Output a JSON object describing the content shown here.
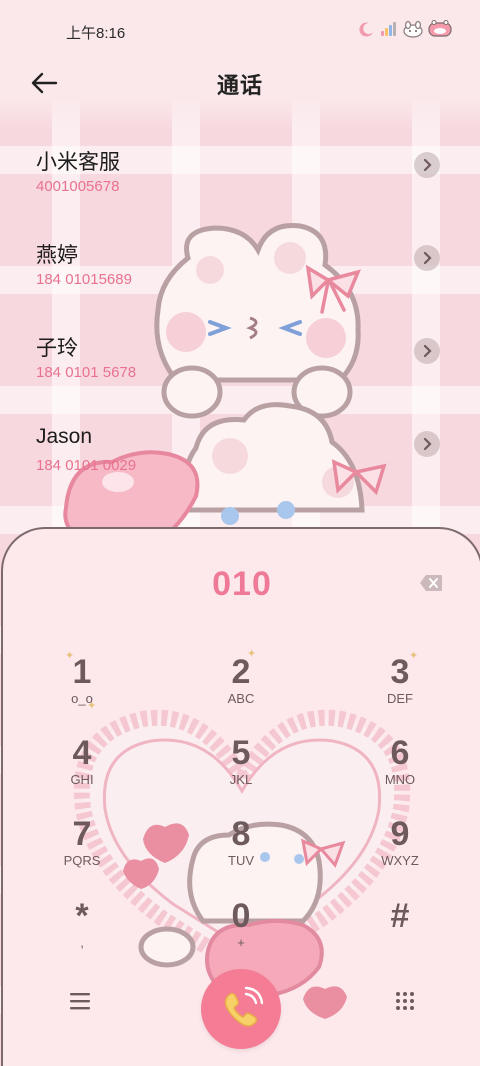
{
  "status_bar": {
    "time": "上午8:16"
  },
  "header": {
    "title": "通话"
  },
  "contacts": [
    {
      "name": "小米客服",
      "number": "4001005678"
    },
    {
      "name": "燕婷",
      "number": "184 01015689"
    },
    {
      "name": "子玲",
      "number": "184 0101 5678"
    },
    {
      "name": "Jason",
      "number": "184 0101 0029"
    }
  ],
  "dialer": {
    "input_value": "010",
    "keys": [
      {
        "digit": "1",
        "letters": "o_o"
      },
      {
        "digit": "2",
        "letters": "ABC"
      },
      {
        "digit": "3",
        "letters": "DEF"
      },
      {
        "digit": "4",
        "letters": "GHI"
      },
      {
        "digit": "5",
        "letters": "JKL"
      },
      {
        "digit": "6",
        "letters": "MNO"
      },
      {
        "digit": "7",
        "letters": "PQRS"
      },
      {
        "digit": "8",
        "letters": "TUV"
      },
      {
        "digit": "9",
        "letters": "WXYZ"
      },
      {
        "digit": "*",
        "letters": ","
      },
      {
        "digit": "0",
        "letters": "+"
      },
      {
        "digit": "#",
        "letters": ""
      }
    ]
  },
  "colors": {
    "accent": "#f57c95",
    "number_text": "#e8728f",
    "key_text": "#6e5a5d"
  },
  "icons": {
    "back": "arrow-left-icon",
    "backspace": "backspace-icon",
    "menu": "menu-icon",
    "call": "phone-icon",
    "keypad": "keypad-icon"
  }
}
